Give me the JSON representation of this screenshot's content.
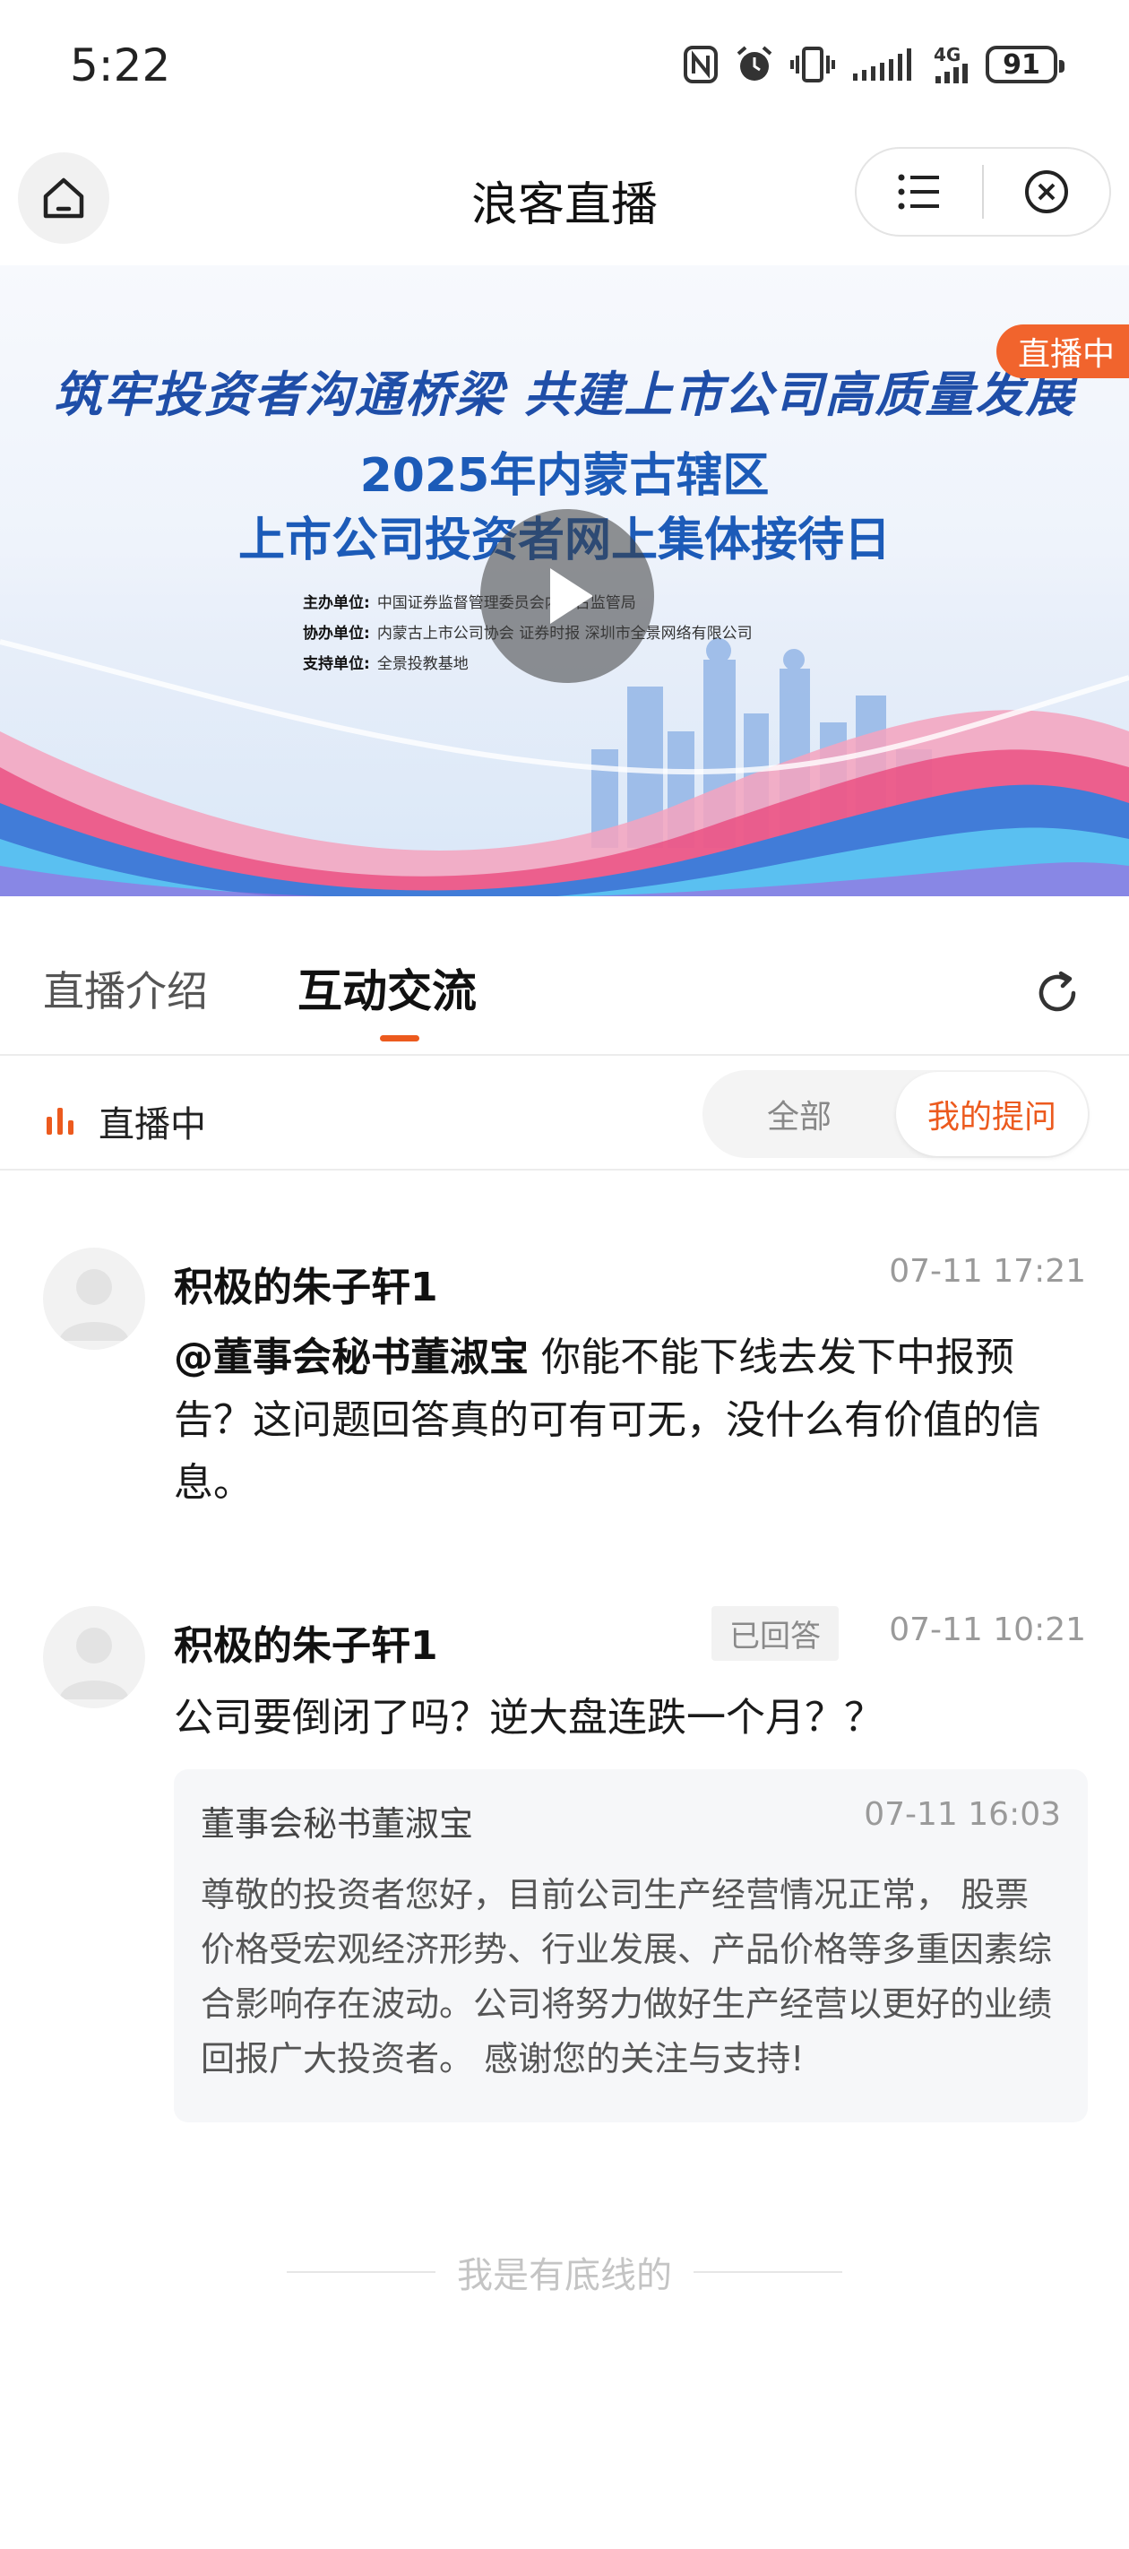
{
  "status_bar": {
    "time": "5:22",
    "network": "4G",
    "battery": "91"
  },
  "header": {
    "title": "浪客直播"
  },
  "banner": {
    "slogan": "筑牢投资者沟通桥梁 共建上市公司高质量发展",
    "line1": "2025年内蒙古辖区",
    "line2": "上市公司投资者网上集体接待日",
    "info": [
      {
        "label": "主办单位:",
        "value": "中国证券监督管理委员会内蒙古监管局"
      },
      {
        "label": "协办单位:",
        "value": "内蒙古上市公司协会 证券时报 深圳市全景网络有限公司"
      },
      {
        "label": "支持单位:",
        "value": "全景投教基地"
      }
    ],
    "live_tag": "直播中"
  },
  "tabs": {
    "items": [
      {
        "label": "直播介绍",
        "active": false
      },
      {
        "label": "互动交流",
        "active": true
      }
    ],
    "accent": "#ec5a1e"
  },
  "filter": {
    "live_label": "直播中",
    "all_label": "全部",
    "mine_label": "我的提问",
    "selected": "我的提问"
  },
  "comments": [
    {
      "user": "积极的朱子轩1",
      "time": "07-11 17:21",
      "mention": "@董事会秘书董淑宝",
      "text": " 你能不能下线去发下中报预告？这问题回答真的可有可无，没什么有价值的信息。"
    },
    {
      "user": "积极的朱子轩1",
      "badge": "已回答",
      "time": "07-11 10:21",
      "text": "公司要倒闭了吗？逆大盘连跌一个月？？",
      "reply": {
        "name": "董事会秘书董淑宝",
        "time": "07-11 16:03",
        "text": "尊敬的投资者您好，目前公司生产经营情况正常， 股票价格受宏观经济形势、行业发展、产品价格等多重因素综合影响存在波动。公司将努力做好生产经营以更好的业绩回报广大投资者。 感谢您的关注与支持!"
      }
    }
  ],
  "footer": {
    "bottom_text": "我是有底线的"
  }
}
